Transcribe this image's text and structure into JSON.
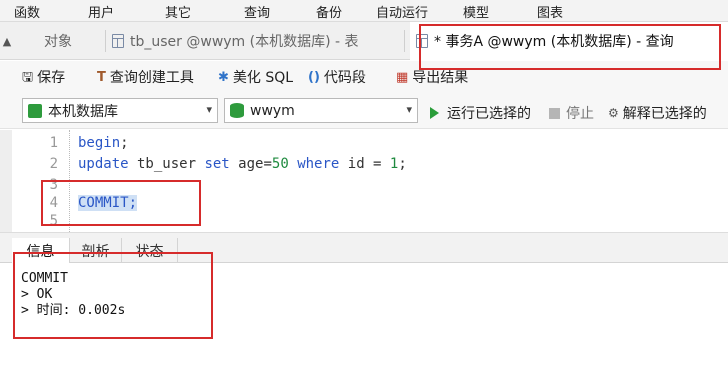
{
  "menu": [
    "函数",
    "用户",
    "其它",
    "查询",
    "备份",
    "自动运行",
    "模型",
    "图表"
  ],
  "tabs": [
    {
      "label": "对象"
    },
    {
      "label": "tb_user @wwym (本机数据库) - 表"
    },
    {
      "label": "* 事务A @wwym (本机数据库) - 查询"
    }
  ],
  "toolbar": {
    "save": "保存",
    "query_builder": "查询创建工具",
    "beautify": "美化 SQL",
    "snippet": "代码段",
    "export": "导出结果"
  },
  "connection": {
    "server": "本机数据库",
    "database": "wwym",
    "run_selected": "运行已选择的",
    "stop": "停止",
    "explain_selected": "解释已选择的"
  },
  "editor": {
    "line_numbers": [
      "1",
      "2",
      "3",
      "4",
      "5"
    ],
    "line1": {
      "kw": "begin",
      "rest": ";"
    },
    "line2": {
      "kw1": "update",
      "t1": " tb_user ",
      "kw2": "set",
      "t2": " age=",
      "n1": "50",
      "t3": " ",
      "kw3": "where",
      "t4": " id = ",
      "n2": "1",
      "t5": ";"
    },
    "line4": {
      "sel": "COMMIT;"
    }
  },
  "result_tabs": [
    "信息",
    "剖析",
    "状态"
  ],
  "output": [
    "COMMIT",
    "> OK",
    "> 时间: 0.002s"
  ],
  "colors": {
    "highlight": "#d62b2b",
    "keyword": "#2a56c6",
    "run": "#2a9d3a"
  }
}
